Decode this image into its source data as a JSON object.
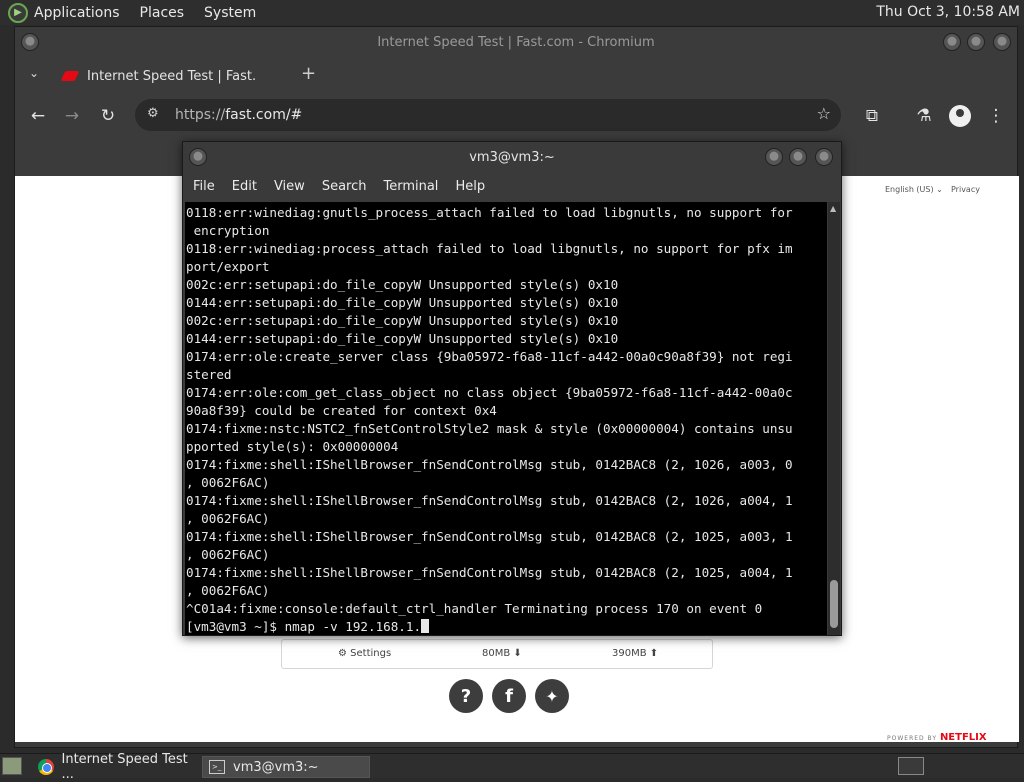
{
  "top_panel": {
    "menus": [
      "Applications",
      "Places",
      "System"
    ],
    "clock": "Thu Oct  3, 10:58 AM"
  },
  "browser": {
    "window_title": "Internet Speed Test | Fast.com - Chromium",
    "tab_title": "Internet Speed Test | Fast.com",
    "url_scheme": "https://",
    "url_rest": "fast.com/#",
    "page": {
      "language": "English (US)",
      "privacy": "Privacy",
      "settings_label": "Settings",
      "latency_unloaded": "80MB",
      "latency_loaded": "390MB",
      "powered_by": "POWERED BY",
      "brand": "NETFLIX"
    }
  },
  "terminal": {
    "title": "vm3@vm3:~",
    "menu": [
      "File",
      "Edit",
      "View",
      "Search",
      "Terminal",
      "Help"
    ],
    "lines": [
      "0118:err:winediag:gnutls_process_attach failed to load libgnutls, no support for",
      " encryption",
      "0118:err:winediag:process_attach failed to load libgnutls, no support for pfx im",
      "port/export",
      "002c:err:setupapi:do_file_copyW Unsupported style(s) 0x10",
      "0144:err:setupapi:do_file_copyW Unsupported style(s) 0x10",
      "002c:err:setupapi:do_file_copyW Unsupported style(s) 0x10",
      "0144:err:setupapi:do_file_copyW Unsupported style(s) 0x10",
      "0174:err:ole:create_server class {9ba05972-f6a8-11cf-a442-00a0c90a8f39} not regi",
      "stered",
      "0174:err:ole:com_get_class_object no class object {9ba05972-f6a8-11cf-a442-00a0c",
      "90a8f39} could be created for context 0x4",
      "0174:fixme:nstc:NSTC2_fnSetControlStyle2 mask & style (0x00000004) contains unsu",
      "pported style(s): 0x00000004",
      "0174:fixme:shell:IShellBrowser_fnSendControlMsg stub, 0142BAC8 (2, 1026, a003, 0",
      ", 0062F6AC)",
      "0174:fixme:shell:IShellBrowser_fnSendControlMsg stub, 0142BAC8 (2, 1026, a004, 1",
      ", 0062F6AC)",
      "0174:fixme:shell:IShellBrowser_fnSendControlMsg stub, 0142BAC8 (2, 1025, a003, 1",
      ", 0062F6AC)",
      "0174:fixme:shell:IShellBrowser_fnSendControlMsg stub, 0142BAC8 (2, 1025, a004, 1",
      ", 0062F6AC)",
      "^C01a4:fixme:console:default_ctrl_handler Terminating process 170 on event 0"
    ],
    "prompt": "[vm3@vm3 ~]$ ",
    "command": "nmap -v 192.168.1."
  },
  "taskbar": {
    "tasks": [
      "Internet Speed Test ...",
      "vm3@vm3:~"
    ]
  }
}
